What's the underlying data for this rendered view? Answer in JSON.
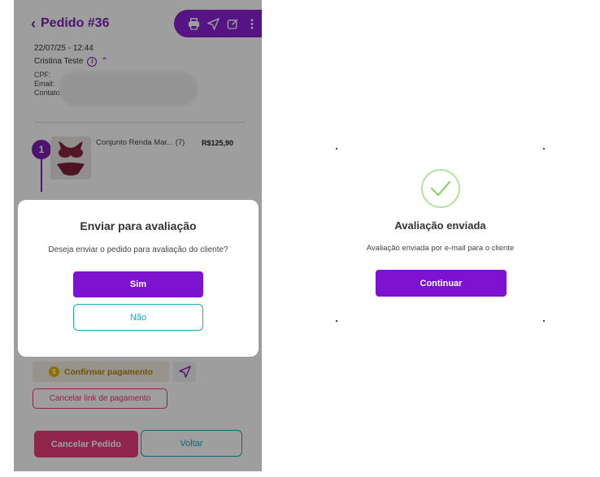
{
  "order": {
    "title": "Pedido #36",
    "datetime": "22/07/25 - 12:44",
    "customer": "Cristina Teste",
    "cpf_label": "CPF:",
    "email_label": "Email:",
    "contact_label": "Contato:"
  },
  "item": {
    "number": "1",
    "name": "Conjunto Renda Mar... (7)",
    "price": "R$125,90"
  },
  "actions": {
    "confirm_payment": "Confirmar pagamento",
    "cancel_payment_link": "Cancelar link de pagamento",
    "cancel_order": "Cancelar Pedido",
    "back": "Voltar"
  },
  "modal": {
    "title": "Enviar para avaliação",
    "text": "Deseja enviar o pedido para avaliação do cliente?",
    "yes": "Sim",
    "no": "Não"
  },
  "success": {
    "title": "Avaliação enviada",
    "text": "Avaliação enviada por e-mail para o cliente",
    "continue": "Continuar"
  },
  "icons": {
    "back": "chevron-left-icon",
    "print": "printer-icon",
    "send": "send-icon",
    "edit": "edit-icon",
    "more": "more-vertical-icon",
    "info": "info-icon",
    "collapse": "chevron-up-icon",
    "coin": "dollar-coin-icon",
    "check": "check-icon"
  },
  "colors": {
    "primary": "#7d12d0",
    "secondary": "#17a7c4",
    "danger": "#e83e7a",
    "gold": "#b8860b",
    "success": "#8fd16f"
  }
}
